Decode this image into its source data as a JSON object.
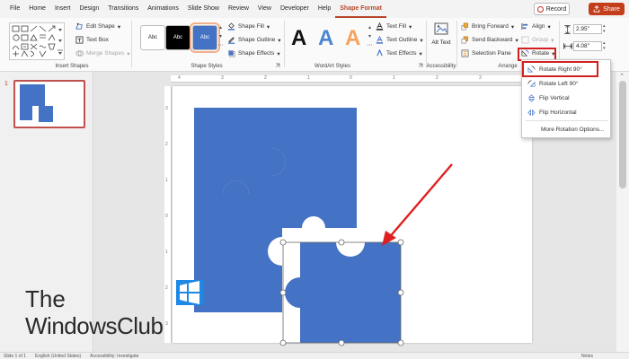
{
  "menu": {
    "tabs": [
      "File",
      "Home",
      "Insert",
      "Design",
      "Transitions",
      "Animations",
      "Slide Show",
      "Review",
      "View",
      "Developer",
      "Help",
      "Shape Format"
    ],
    "active_tab": "Shape Format",
    "record_label": "Record",
    "share_label": "Share"
  },
  "ribbon": {
    "insert_shapes": {
      "label": "Insert Shapes",
      "edit_shape": "Edit Shape",
      "text_box": "Text Box",
      "merge_shapes": "Merge Shapes"
    },
    "shape_styles": {
      "label": "Shape Styles",
      "swatches": [
        {
          "text": "Abc",
          "bg": "#ffffff",
          "fg": "#262626"
        },
        {
          "text": "Abc",
          "bg": "#000000",
          "fg": "#ffffff"
        },
        {
          "text": "Abc",
          "bg": "#4472c4",
          "fg": "#ffffff"
        }
      ],
      "shape_fill": "Shape Fill",
      "shape_outline": "Shape Outline",
      "shape_effects": "Shape Effects"
    },
    "wordart": {
      "label": "WordArt Styles",
      "letters": [
        {
          "text": "A",
          "color": "#111111"
        },
        {
          "text": "A",
          "color": "#4a86d0"
        },
        {
          "text": "A",
          "color": "#f5a25d"
        }
      ],
      "text_fill": "Text Fill",
      "text_outline": "Text Outline",
      "text_effects": "Text Effects"
    },
    "accessibility": {
      "label": "Accessibility",
      "alt_text": "Alt Text"
    },
    "arrange": {
      "label": "Arrange",
      "bring_forward": "Bring Forward",
      "send_backward": "Send Backward",
      "selection_pane": "Selection Pane",
      "align": "Align",
      "group": "Group",
      "rotate": "Rotate"
    },
    "size": {
      "height": "2.95\"",
      "width": "4.08\""
    }
  },
  "rotate_menu": {
    "items": [
      "Rotate Right 90°",
      "Rotate Left 90°",
      "Flip Vertical",
      "Flip Horizontal",
      "More Rotation Options..."
    ]
  },
  "slides": {
    "number": "1"
  },
  "ruler": {
    "top_marks": [
      "4",
      "3",
      "2",
      "1",
      "0",
      "1",
      "2",
      "3",
      "4"
    ],
    "left_marks": [
      "3",
      "2",
      "1",
      "0",
      "1",
      "2",
      "3"
    ]
  },
  "status": {
    "slide_info": "Slide 1 of 1",
    "language": "English (United States)",
    "accessibility": "Accessibility: Investigate",
    "notes": "Notes"
  },
  "watermark": {
    "line1": "The",
    "line2": "WindowsClub"
  },
  "colors": {
    "accent": "#b7472a",
    "puzzle_blue": "#4472c4",
    "highlight_red": "#d21f1f"
  }
}
